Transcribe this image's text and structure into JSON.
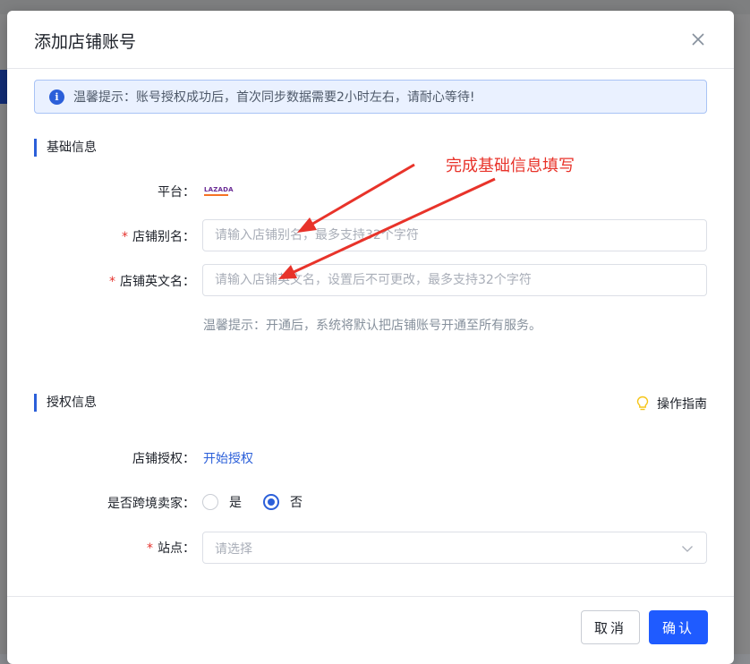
{
  "dialog": {
    "title": "添加店铺账号",
    "close_icon": "close-icon"
  },
  "alert": {
    "icon": "info-icon",
    "icon_glyph": "i",
    "text": "温馨提示：账号授权成功后，首次同步数据需要2小时左右，请耐心等待!"
  },
  "basic_section": {
    "title": "基础信息",
    "platform_label": "平台：",
    "platform_logo_text": "LAZADA",
    "alias_label": "店铺别名：",
    "alias_placeholder": "请输入店铺别名，最多支持32个字符",
    "english_label": "店铺英文名：",
    "english_placeholder": "请输入店铺英文名，设置后不可更改，最多支持32个字符",
    "required_mark": "*",
    "hint": "温馨提示：开通后，系统将默认把店铺账号开通至所有服务。"
  },
  "annotation": {
    "text": "完成基础信息填写",
    "color": "#e8332a"
  },
  "auth_section": {
    "title": "授权信息",
    "guide_label": "操作指南",
    "guide_icon": "lightbulb-icon",
    "shop_auth_label": "店铺授权：",
    "shop_auth_link": "开始授权",
    "cross_border_label": "是否跨境卖家：",
    "options": [
      {
        "label": "是",
        "checked": false
      },
      {
        "label": "否",
        "checked": true
      }
    ],
    "site_label": "站点：",
    "site_placeholder": "请选择",
    "required_mark": "*"
  },
  "footer": {
    "cancel_label": "取消",
    "ok_label": "确认"
  },
  "colors": {
    "primary": "#1f5bff",
    "link": "#2b5fd9",
    "required": "#e5322d"
  }
}
